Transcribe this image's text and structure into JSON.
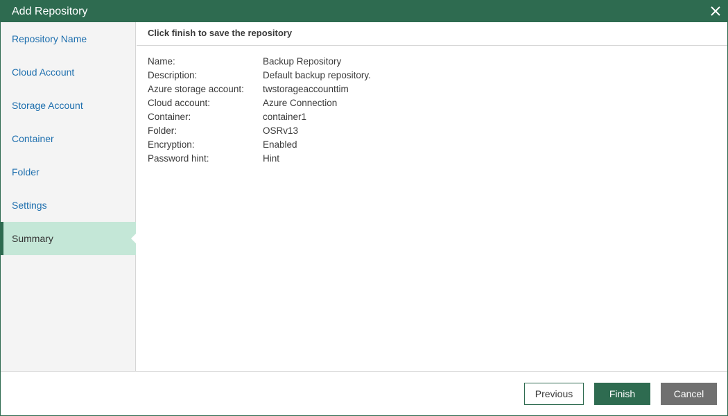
{
  "window": {
    "title": "Add Repository",
    "close_icon": "close-icon"
  },
  "sidebar": {
    "items": [
      {
        "label": "Repository Name",
        "active": false
      },
      {
        "label": "Cloud Account",
        "active": false
      },
      {
        "label": "Storage Account",
        "active": false
      },
      {
        "label": "Container",
        "active": false
      },
      {
        "label": "Folder",
        "active": false
      },
      {
        "label": "Settings",
        "active": false
      },
      {
        "label": "Summary",
        "active": true
      }
    ]
  },
  "main": {
    "header": "Click finish to save the repository",
    "summary": [
      {
        "label": "Name:",
        "value": "Backup Repository"
      },
      {
        "label": "Description:",
        "value": "Default backup repository."
      },
      {
        "label": "Azure storage account:",
        "value": "twstorageaccounttim"
      },
      {
        "label": "Cloud account:",
        "value": "Azure Connection"
      },
      {
        "label": "Container:",
        "value": "container1"
      },
      {
        "label": "Folder:",
        "value": "OSRv13"
      },
      {
        "label": "Encryption:",
        "value": "Enabled"
      },
      {
        "label": "Password hint:",
        "value": "Hint"
      }
    ]
  },
  "footer": {
    "previous_label": "Previous",
    "finish_label": "Finish",
    "cancel_label": "Cancel"
  },
  "colors": {
    "accent": "#2e6b50",
    "active_nav_bg": "#c4e7d7",
    "link": "#1e6fae",
    "cancel_bg": "#707070"
  }
}
